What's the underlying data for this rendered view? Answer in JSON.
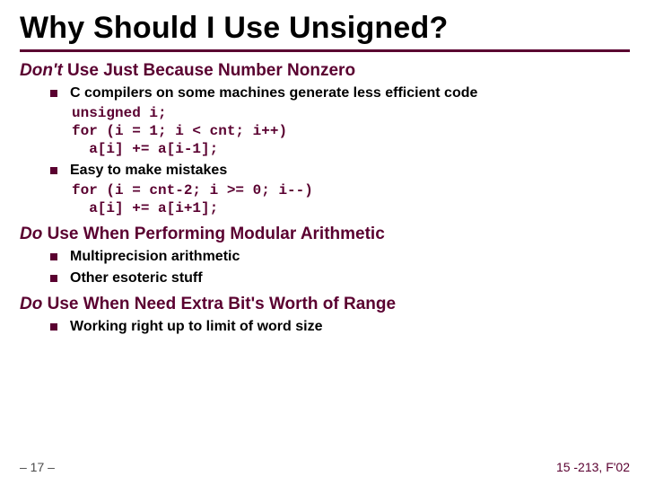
{
  "title": "Why Should I Use Unsigned?",
  "section1": {
    "prefix": "Don't",
    "rest": " Use Just Because Number Nonzero"
  },
  "b1": "C compilers on some machines generate less efficient code",
  "code1": "unsigned i;\nfor (i = 1; i < cnt; i++)\n  a[i] += a[i-1];",
  "b2": "Easy to make mistakes",
  "code2": "for (i = cnt-2; i >= 0; i--)\n  a[i] += a[i+1];",
  "section2": {
    "prefix": "Do",
    "rest": " Use When Performing Modular Arithmetic"
  },
  "b3": "Multiprecision arithmetic",
  "b4": "Other esoteric stuff",
  "section3": {
    "prefix": "Do",
    "rest": " Use When Need Extra Bit's Worth of Range"
  },
  "b5": "Working right up to limit of word size",
  "footer": {
    "left": "– 17 –",
    "right": "15 -213, F'02"
  }
}
